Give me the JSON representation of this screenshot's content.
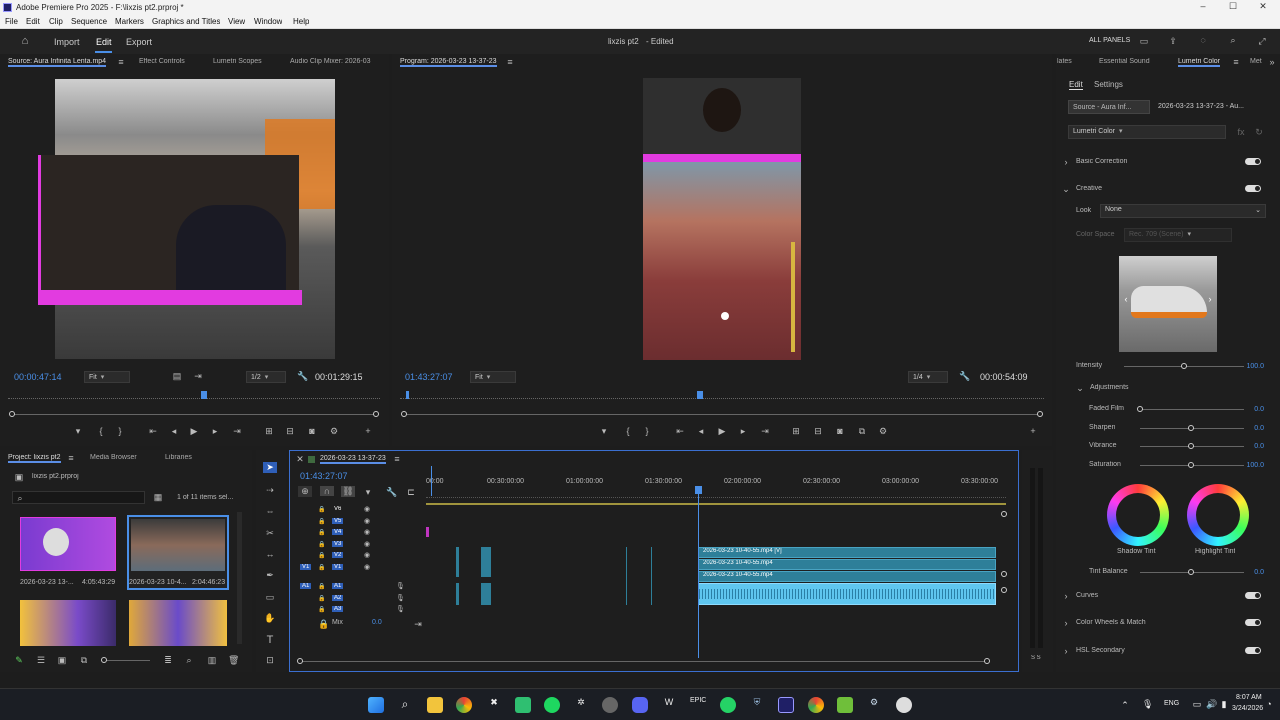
{
  "titlebar": {
    "title": "Adobe Premiere Pro 2025 - F:\\lixzis pt2.prproj *"
  },
  "menu": [
    "File",
    "Edit",
    "Clip",
    "Sequence",
    "Markers",
    "Graphics and Titles",
    "View",
    "Window",
    "Help"
  ],
  "workspace": {
    "tabs": [
      "Import",
      "Edit",
      "Export"
    ],
    "active": "Edit",
    "center_title": "lixzis pt2",
    "center_status": "- Edited",
    "all_panels": "ALL PANELS"
  },
  "source_panel": {
    "tabs": [
      "Source: Aura Infinita Lenta.mp4",
      "Effect Controls",
      "Lumetri Scopes",
      "Audio Clip Mixer: 2026-03"
    ],
    "timecode": "00:00:47:14",
    "fit": "Fit",
    "res": "1/2",
    "duration": "00:01:29:15"
  },
  "program_panel": {
    "title": "Program: 2026-03-23 13-37-23",
    "timecode": "01:43:27:07",
    "fit": "Fit",
    "res": "1/4",
    "duration": "00:00:54:09"
  },
  "project_panel": {
    "tabs": [
      "Project: lixzis pt2",
      "Media Browser",
      "Libraries"
    ],
    "filename": "lixzis pt2.prproj",
    "items_count": "1 of 11 items sel...",
    "thumbs": [
      {
        "name": "2026-03-23 13-...",
        "dur": "4:05:43:29"
      },
      {
        "name": "2026-03-23 10-4...",
        "dur": "2:04:46:23"
      }
    ]
  },
  "timeline": {
    "sequence": "2026-03-23 13-37-23",
    "timecode": "01:43:27:07",
    "ruler": [
      "00:00",
      "00:30:00:00",
      "01:00:00:00",
      "01:30:00:00",
      "02:00:00:00",
      "02:30:00:00",
      "03:00:00:00",
      "03:30:00:00"
    ],
    "video_tracks": [
      "V6",
      "V5",
      "V4",
      "V3",
      "V2",
      "V1"
    ],
    "audio_tracks": [
      "A1",
      "A2",
      "A3"
    ],
    "mix_label": "Mix",
    "mix_value": "0.0",
    "clips": [
      "2026-03-23 10-40-55.mp4 [V]",
      "2026-03-23 10-40-55.mp4",
      "2026-03-23 10-40-55.mp4"
    ],
    "meter_label": "S S"
  },
  "right_panel": {
    "tabs": [
      "lates",
      "Essential Sound",
      "Lumetri Color",
      "Met"
    ],
    "subtabs": [
      "Edit",
      "Settings"
    ],
    "source_btn": "Source - Aura Inf...",
    "seq_btn": "2026-03-23 13-37-23 - Au...",
    "effect": "Lumetri Color",
    "sections": {
      "basic": "Basic Correction",
      "creative": "Creative",
      "curves": "Curves",
      "wheels": "Color Wheels & Match",
      "hsl": "HSL Secondary"
    },
    "look_label": "Look",
    "look_value": "None",
    "colorspace_label": "Color Space",
    "colorspace_value": "Rec. 709 (Scene)",
    "intensity_label": "Intensity",
    "intensity_value": "100.0",
    "adjustments": "Adjustments",
    "faded_film_label": "Faded Film",
    "faded_film": "0.0",
    "sharpen_label": "Sharpen",
    "sharpen": "0.0",
    "vibrance_label": "Vibrance",
    "vibrance": "0.0",
    "saturation_label": "Saturation",
    "saturation": "100.0",
    "shadow_tint": "Shadow Tint",
    "highlight_tint": "Highlight Tint",
    "tint_balance_label": "Tint Balance",
    "tint_balance": "0.0"
  },
  "tray": {
    "lang": "ENG",
    "time": "8:07 AM",
    "date": "3/24/2026"
  },
  "colors": {
    "accent": "#4a8fe7",
    "clip": "#2e7f99",
    "magenta": "#e23be0",
    "audio": "#5fc6ef"
  }
}
